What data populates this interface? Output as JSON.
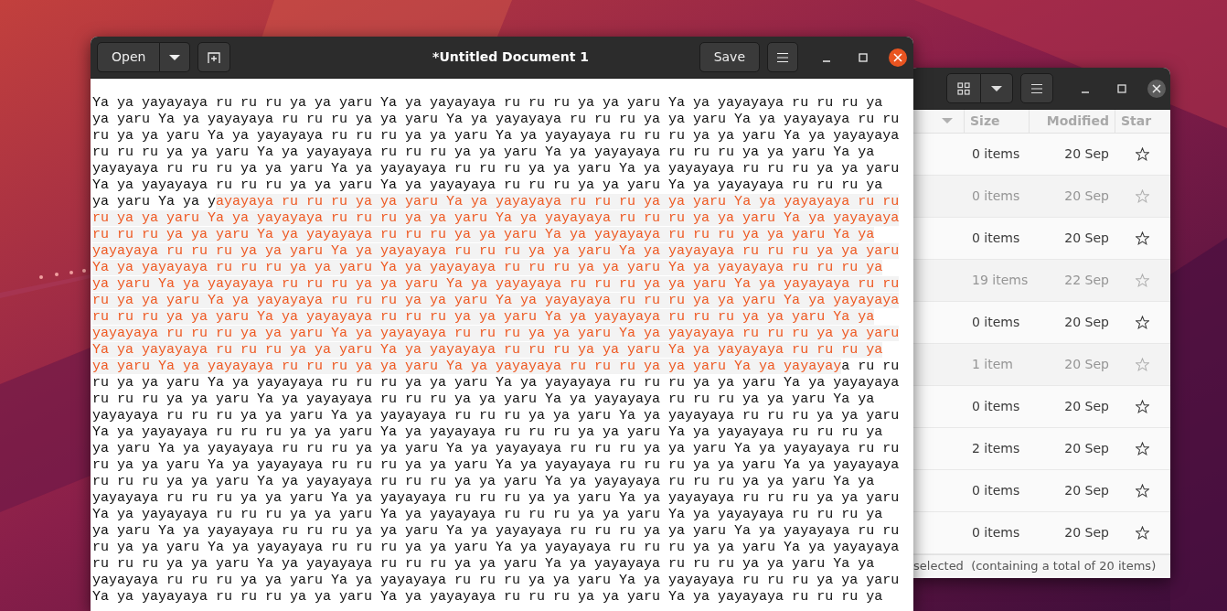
{
  "editor": {
    "buttons": {
      "open": "Open",
      "save": "Save"
    },
    "title": "*Untitled Document 1",
    "lines": [
      [
        {
          "text": "Ya ya yayayaya ru ru ru ya ya yaru Ya ya yayayaya ru ru ru ya ya yaru Ya ya yayayaya ru ru ru ya",
          "selected": false
        }
      ],
      [
        {
          "text": "ya yaru Ya ya yayayaya ru ru ru ya ya yaru Ya ya yayayaya ru ru ru ya ya yaru Ya ya yayayaya ru ru",
          "selected": false
        }
      ],
      [
        {
          "text": "ru ya ya yaru Ya ya yayayaya ru ru ru ya ya yaru Ya ya yayayaya ru ru ru ya ya yaru Ya ya yayayaya",
          "selected": false
        }
      ],
      [
        {
          "text": "ru ru ru ya ya yaru Ya ya yayayaya ru ru ru ya ya yaru Ya ya yayayaya ru ru ru ya ya yaru Ya ya",
          "selected": false
        }
      ],
      [
        {
          "text": "yayayaya ru ru ru ya ya yaru Ya ya yayayaya ru ru ru ya ya yaru Ya ya yayayaya ru ru ru ya ya yaru",
          "selected": false
        }
      ],
      [
        {
          "text": "Ya ya yayayaya ru ru ru ya ya yaru Ya ya yayayaya ru ru ru ya ya yaru Ya ya yayayaya ru ru ru ya",
          "selected": false
        }
      ],
      [
        {
          "text": "ya yaru Ya ya y",
          "selected": false
        },
        {
          "text": "ayayaya ru ru ru ya ya yaru Ya ya yayayaya ru ru ru ya ya yaru Ya ya yayayaya ru ru",
          "selected": true
        }
      ],
      [
        {
          "text": "ru ya ya yaru Ya ya yayayaya ru ru ru ya ya yaru Ya ya yayayaya ru ru ru ya ya yaru Ya ya yayayaya",
          "selected": true
        }
      ],
      [
        {
          "text": "ru ru ru ya ya yaru Ya ya yayayaya ru ru ru ya ya yaru Ya ya yayayaya ru ru ru ya ya yaru Ya ya",
          "selected": true
        }
      ],
      [
        {
          "text": "yayayaya ru ru ru ya ya yaru Ya ya yayayaya ru ru ru ya ya yaru Ya ya yayayaya ru ru ru ya ya yaru",
          "selected": true
        }
      ],
      [
        {
          "text": "Ya ya yayayaya ru ru ru ya ya yaru Ya ya yayayaya ru ru ru ya ya yaru Ya ya yayayaya ru ru ru ya",
          "selected": true
        }
      ],
      [
        {
          "text": "ya yaru Ya ya yayayaya ru ru ru ya ya yaru Ya ya yayayaya ru ru ru ya ya yaru Ya ya yayayaya ru ru",
          "selected": true
        }
      ],
      [
        {
          "text": "ru ya ya yaru Ya ya yayayaya ru ru ru ya ya yaru Ya ya yayayaya ru ru ru ya ya yaru Ya ya yayayaya",
          "selected": true
        }
      ],
      [
        {
          "text": "ru ru ru ya ya yaru Ya ya yayayaya ru ru ru ya ya yaru Ya ya yayayaya ru ru ru ya ya yaru Ya ya",
          "selected": true
        }
      ],
      [
        {
          "text": "yayayaya ru ru ru ya ya yaru Ya ya yayayaya ru ru ru ya ya yaru Ya ya yayayaya ru ru ru ya ya yaru",
          "selected": true
        }
      ],
      [
        {
          "text": "Ya ya yayayaya ru ru ru ya ya yaru Ya ya yayayaya ru ru ru ya ya yaru Ya ya yayayaya ru ru ru ya",
          "selected": true
        }
      ],
      [
        {
          "text": "ya yaru Ya ya yayayaya ru ru ru ya ya yaru Ya ya yayayaya ru ru ru ya ya yaru Ya ya yayayay",
          "selected": true
        },
        {
          "text": "a ru ru",
          "selected": false
        }
      ],
      [
        {
          "text": "ru ya ya yaru Ya ya yayayaya ru ru ru ya ya yaru Ya ya yayayaya ru ru ru ya ya yaru Ya ya yayayaya",
          "selected": false
        }
      ],
      [
        {
          "text": "ru ru ru ya ya yaru Ya ya yayayaya ru ru ru ya ya yaru Ya ya yayayaya ru ru ru ya ya yaru Ya ya",
          "selected": false
        }
      ],
      [
        {
          "text": "yayayaya ru ru ru ya ya yaru Ya ya yayayaya ru ru ru ya ya yaru Ya ya yayayaya ru ru ru ya ya yaru",
          "selected": false
        }
      ],
      [
        {
          "text": "Ya ya yayayaya ru ru ru ya ya yaru Ya ya yayayaya ru ru ru ya ya yaru Ya ya yayayaya ru ru ru ya",
          "selected": false
        }
      ],
      [
        {
          "text": "ya yaru Ya ya yayayaya ru ru ru ya ya yaru Ya ya yayayaya ru ru ru ya ya yaru Ya ya yayayaya ru ru",
          "selected": false
        }
      ],
      [
        {
          "text": "ru ya ya yaru Ya ya yayayaya ru ru ru ya ya yaru Ya ya yayayaya ru ru ru ya ya yaru Ya ya yayayaya",
          "selected": false
        }
      ],
      [
        {
          "text": "ru ru ru ya ya yaru Ya ya yayayaya ru ru ru ya ya yaru Ya ya yayayaya ru ru ru ya ya yaru Ya ya",
          "selected": false
        }
      ],
      [
        {
          "text": "yayayaya ru ru ru ya ya yaru Ya ya yayayaya ru ru ru ya ya yaru Ya ya yayayaya ru ru ru ya ya yaru",
          "selected": false
        }
      ],
      [
        {
          "text": "Ya ya yayayaya ru ru ru ya ya yaru Ya ya yayayaya ru ru ru ya ya yaru Ya ya yayayaya ru ru ru ya",
          "selected": false
        }
      ],
      [
        {
          "text": "ya yaru Ya ya yayayaya ru ru ru ya ya yaru Ya ya yayayaya ru ru ru ya ya yaru Ya ya yayayaya ru ru",
          "selected": false
        }
      ],
      [
        {
          "text": "ru ya ya yaru Ya ya yayayaya ru ru ru ya ya yaru Ya ya yayayaya ru ru ru ya ya yaru Ya ya yayayaya",
          "selected": false
        }
      ],
      [
        {
          "text": "ru ru ru ya ya yaru Ya ya yayayaya ru ru ru ya ya yaru Ya ya yayayaya ru ru ru ya ya yaru Ya ya",
          "selected": false
        }
      ],
      [
        {
          "text": "yayayaya ru ru ru ya ya yaru Ya ya yayayaya ru ru ru ya ya yaru Ya ya yayayaya ru ru ru ya ya yaru",
          "selected": false
        }
      ],
      [
        {
          "text": "Ya ya yayayaya ru ru ru ya ya yaru Ya ya yayayaya ru ru ru ya ya yaru Ya ya yayayaya ru ru ru ya",
          "selected": false
        }
      ]
    ]
  },
  "file_manager": {
    "name_column": {
      "sorted": true
    },
    "columns": [
      "Size",
      "Modified",
      "Star"
    ],
    "rows": [
      {
        "size": "0 items",
        "modified": "20 Sep",
        "starred": false,
        "faded": false
      },
      {
        "size": "0 items",
        "modified": "20 Sep",
        "starred": false,
        "faded": true
      },
      {
        "size": "0 items",
        "modified": "20 Sep",
        "starred": false,
        "faded": false
      },
      {
        "size": "19 items",
        "modified": "22 Sep",
        "starred": false,
        "faded": true
      },
      {
        "size": "0 items",
        "modified": "20 Sep",
        "starred": false,
        "faded": false
      },
      {
        "size": "1 item",
        "modified": "20 Sep",
        "starred": false,
        "faded": true
      },
      {
        "size": "0 items",
        "modified": "20 Sep",
        "starred": false,
        "faded": false
      },
      {
        "size": "2 items",
        "modified": "20 Sep",
        "starred": false,
        "faded": false
      },
      {
        "size": "0 items",
        "modified": "20 Sep",
        "starred": false,
        "faded": false
      },
      {
        "size": "0 items",
        "modified": "20 Sep",
        "starred": false,
        "faded": false
      }
    ],
    "status_bar": "selected  (containing a total of 20 items)"
  }
}
